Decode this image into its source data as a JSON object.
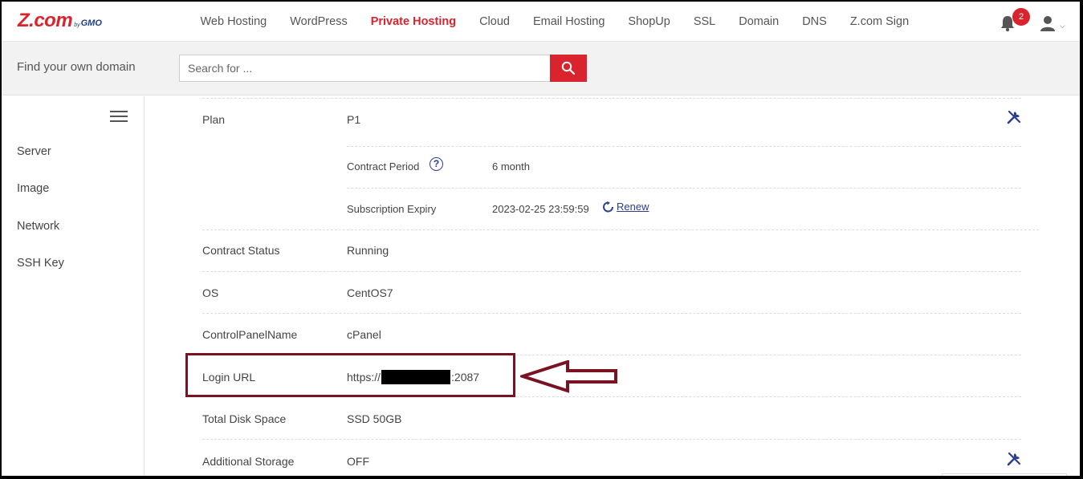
{
  "brand": {
    "logo_main": "Z.com",
    "logo_by": "by",
    "logo_gmo": "GMO"
  },
  "nav": {
    "items": [
      {
        "label": "Web Hosting",
        "active": false
      },
      {
        "label": "WordPress",
        "active": false
      },
      {
        "label": "Private Hosting",
        "active": true
      },
      {
        "label": "Cloud",
        "active": false
      },
      {
        "label": "Email Hosting",
        "active": false
      },
      {
        "label": "ShopUp",
        "active": false
      },
      {
        "label": "SSL",
        "active": false
      },
      {
        "label": "Domain",
        "active": false
      },
      {
        "label": "DNS",
        "active": false
      },
      {
        "label": "Z.com Sign",
        "active": false
      }
    ],
    "notification_count": "2",
    "icons": {
      "bell": "bell-icon",
      "user": "user-icon",
      "caret": "chevron-down-icon"
    }
  },
  "domain_search": {
    "label": "Find your own domain",
    "placeholder": "Search for ...",
    "button_icon": "search-icon"
  },
  "sidebar": {
    "menu_icon": "hamburger-icon",
    "items": [
      {
        "label": "Server"
      },
      {
        "label": "Image"
      },
      {
        "label": "Network"
      },
      {
        "label": "SSH Key"
      }
    ]
  },
  "details": {
    "plan": {
      "label": "Plan",
      "value": "P1"
    },
    "contract_period": {
      "label": "Contract Period",
      "value": "6 month"
    },
    "subscription_expiry": {
      "label": "Subscription Expiry",
      "value": "2023-02-25 23:59:59",
      "renew_label": "Renew"
    },
    "contract_status": {
      "label": "Contract Status",
      "value": "Running"
    },
    "os": {
      "label": "OS",
      "value": "CentOS7"
    },
    "control_panel": {
      "label": "ControlPanelName",
      "value": "cPanel"
    },
    "login_url": {
      "label": "Login URL",
      "prefix": "https://",
      "suffix": ":2087"
    },
    "disk_space": {
      "label": "Total Disk Space",
      "value": "SSD 50GB"
    },
    "additional_storage": {
      "label": "Additional Storage",
      "value": "OFF"
    }
  },
  "colors": {
    "accent": "#d9232d",
    "brand_blue": "#1d3e8a",
    "annotation": "#7a1222"
  }
}
